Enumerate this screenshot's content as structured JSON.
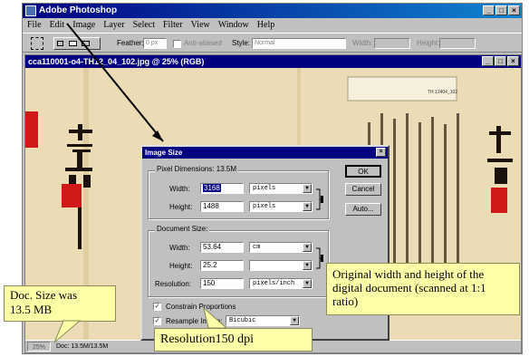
{
  "app": {
    "title": "Adobe Photoshop",
    "window_buttons": [
      "_",
      "□",
      "×"
    ]
  },
  "menu": [
    "File",
    "Edit",
    "Image",
    "Layer",
    "Select",
    "Filter",
    "View",
    "Window",
    "Help"
  ],
  "options_bar": {
    "feather_label": "Feather:",
    "feather_value": "0 px",
    "antialiased_label": "Anti-aliased",
    "style_label": "Style:",
    "style_value": "Normal",
    "width_label": "Width:",
    "height_label": "Height:"
  },
  "document": {
    "title": "cca110001-o4-TH12_04_102.jpg @ 25% (RGB)",
    "zoom": "25%",
    "doc_size": "Doc: 13.5M/13.5M",
    "window_buttons": [
      "_",
      "□",
      "×"
    ],
    "stamp_text": "TH 12404_102"
  },
  "dialog": {
    "title": "Image Size",
    "pixel_dimensions": {
      "label": "Pixel Dimensions: 13.5M",
      "width_label": "Width:",
      "width_value": "3168",
      "width_unit": "pixels",
      "height_label": "Height:",
      "height_value": "1488",
      "height_unit": "pixels"
    },
    "document_size": {
      "label": "Document Size:",
      "width_label": "Width:",
      "width_value": "53.64",
      "width_unit": "cm",
      "height_label": "Height:",
      "height_value": "25.2",
      "resolution_label": "Resolution:",
      "resolution_value": "150",
      "resolution_unit": "pixels/inch"
    },
    "constrain_label": "Constrain Proportions",
    "resample_label": "Resample Image:",
    "resample_value": "Bicubic",
    "ok_label": "OK",
    "cancel_label": "Cancel",
    "auto_label": "Auto..."
  },
  "callouts": {
    "original_size": "Original width and height of the digital document (scanned at 1:1 ratio)",
    "doc_size_line1": "Doc. Size was",
    "doc_size_line2": "13.5 MB",
    "resolution": "Resolution150 dpi"
  },
  "colors": {
    "title_bar": "#000080",
    "window_face": "#c0c0c0",
    "paper": "#ebdcb5",
    "seal_red": "#d21919",
    "callout_bg": "#ffffa8"
  }
}
